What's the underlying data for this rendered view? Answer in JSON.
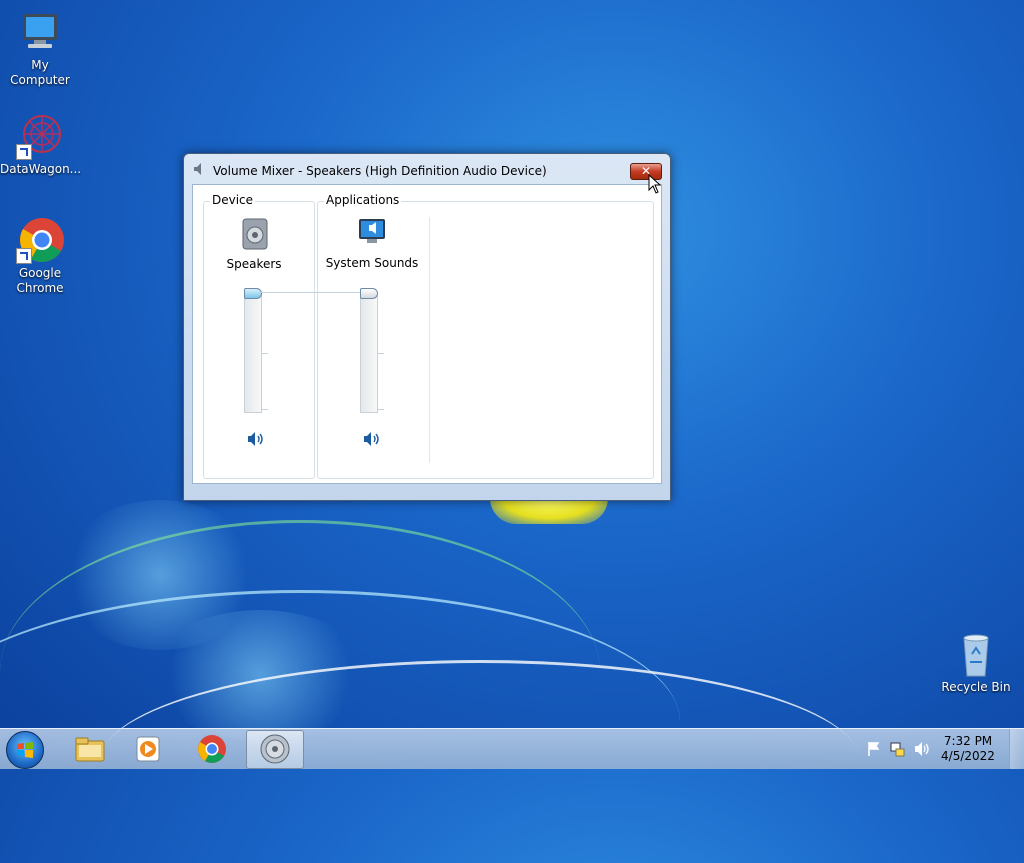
{
  "desktop": {
    "icons": [
      {
        "label": "My Computer",
        "icon": "computer-icon"
      },
      {
        "label": "DataWagon...",
        "icon": "datawagon-icon"
      },
      {
        "label": "Google Chrome",
        "icon": "chrome-icon"
      },
      {
        "label": "Recycle Bin",
        "icon": "recycle-bin-icon"
      }
    ]
  },
  "window": {
    "title": "Volume Mixer - Speakers (High Definition Audio Device)",
    "close_label": "✕",
    "device_group_label": "Device",
    "applications_group_label": "Applications",
    "device": {
      "label": "Speakers",
      "volume_percent": 100
    },
    "applications": [
      {
        "label": "System Sounds",
        "volume_percent": 100
      }
    ]
  },
  "taskbar": {
    "clock_time": "7:32 PM",
    "clock_date": "4/5/2022",
    "pinned": [
      "start-button",
      "file-explorer",
      "media-player",
      "chrome",
      "volume-mixer"
    ]
  },
  "colors": {
    "desktop_accent": "#1a66c9",
    "close_button": "#c43b22"
  }
}
